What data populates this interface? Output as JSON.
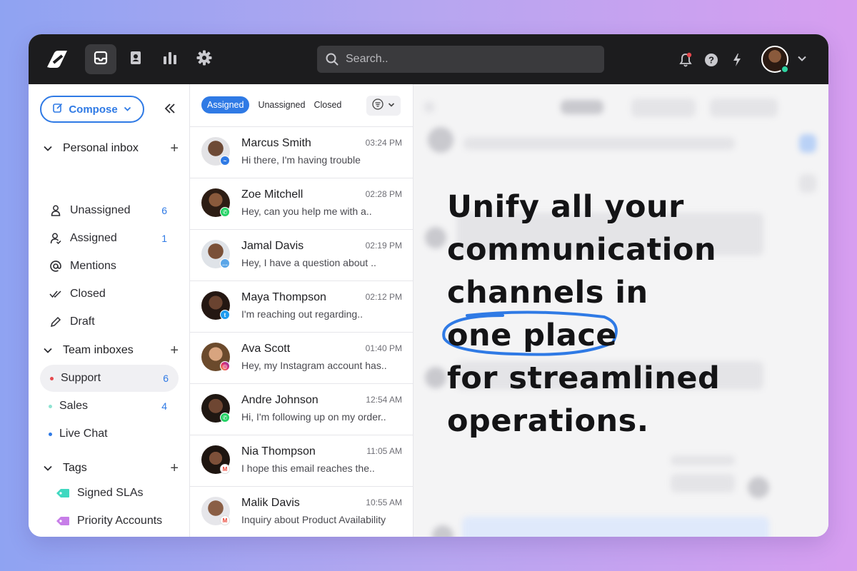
{
  "topbar": {
    "search_placeholder": "Search..",
    "nav": [
      "inbox-icon",
      "contacts-icon",
      "reports-icon",
      "settings-icon"
    ],
    "icons": [
      "bell-icon",
      "help-icon",
      "lightning-icon"
    ]
  },
  "sidebar": {
    "compose_label": "Compose",
    "personal": {
      "title": "Personal inbox",
      "items": [
        {
          "label": "Unassigned",
          "count": "6",
          "icon": "user-icon"
        },
        {
          "label": "Assigned",
          "count": "1",
          "icon": "user-check-icon"
        },
        {
          "label": "Mentions",
          "count": "",
          "icon": "at-icon"
        },
        {
          "label": "Closed",
          "count": "",
          "icon": "double-check-icon"
        },
        {
          "label": "Draft",
          "count": "",
          "icon": "pencil-icon"
        }
      ]
    },
    "team": {
      "title": "Team inboxes",
      "items": [
        {
          "label": "Support",
          "count": "6",
          "dot": "#e5484d"
        },
        {
          "label": "Sales",
          "count": "4",
          "dot": "#8fe3d2"
        },
        {
          "label": "Live Chat",
          "count": "",
          "dot": "#2f7ae5"
        }
      ]
    },
    "tags": {
      "title": "Tags",
      "items": [
        {
          "label": "Signed SLAs",
          "color": "#3fd8c0"
        },
        {
          "label": "Priority Accounts",
          "color": "#c77ee8"
        }
      ]
    }
  },
  "list": {
    "filters": [
      "Assigned",
      "Unassigned",
      "Closed"
    ],
    "conversations": [
      {
        "name": "Marcus Smith",
        "time": "03:24 PM",
        "preview": "Hi there, I'm having trouble",
        "channel": "messenger-icon"
      },
      {
        "name": "Zoe Mitchell",
        "time": "02:28 PM",
        "preview": "Hey, can you help me with a..",
        "channel": "whatsapp-icon"
      },
      {
        "name": "Jamal Davis",
        "time": "02:19 PM",
        "preview": "Hey, I have a question about ..",
        "channel": "chat-icon"
      },
      {
        "name": "Maya Thompson",
        "time": "02:12 PM",
        "preview": "I'm reaching out regarding..",
        "channel": "twitter-icon"
      },
      {
        "name": "Ava Scott",
        "time": "01:40 PM",
        "preview": "Hey, my Instagram account has..",
        "channel": "instagram-icon"
      },
      {
        "name": "Andre Johnson",
        "time": "12:54 AM",
        "preview": " Hi, I'm following up on my order..",
        "channel": "whatsapp-icon"
      },
      {
        "name": "Nia Thompson",
        "time": "11:05 AM",
        "preview": "I hope this email reaches the..",
        "channel": "gmail-icon"
      },
      {
        "name": "Malik Davis",
        "time": "10:55 AM",
        "preview": "Inquiry about Product Availability",
        "channel": "gmail-icon"
      }
    ]
  },
  "tagline": {
    "line1": "Unify all your",
    "line2": "communication",
    "line3a": "channels in ",
    "line3b": "one place",
    "line4": "for streamlined",
    "line5": "operations."
  }
}
